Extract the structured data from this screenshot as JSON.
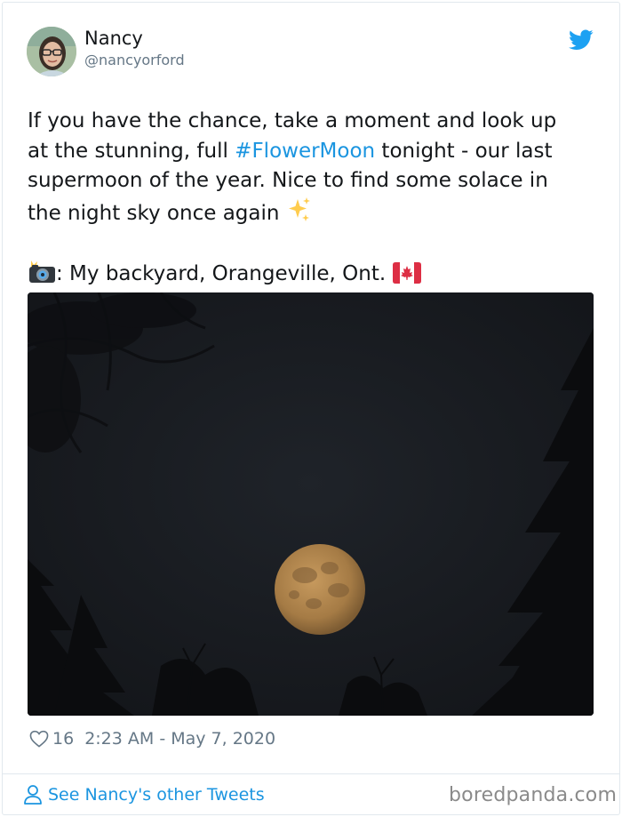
{
  "user": {
    "name": "Nancy",
    "handle": "@nancyorford"
  },
  "tweet": {
    "line1": "If you have the chance, take a moment and look up",
    "line2_start": "at the stunning, full ",
    "hashtag": "#FlowerMoon",
    "line2_end": " tonight - our last",
    "line3": "supermoon of the year. Nice to find some solace in",
    "line4": "the night sky once again",
    "line5_text": ": My backyard, Orangeville, Ont."
  },
  "meta": {
    "likes": "16",
    "timestamp": "2:23 AM - May 7, 2020"
  },
  "footer": {
    "see_more": "See Nancy's other Tweets",
    "watermark": "boredpanda.com"
  },
  "icons": {
    "like": "heart-icon",
    "profile": "person-icon",
    "brand": "twitter-bird-icon",
    "sparkles": "sparkles-emoji",
    "camera": "camera-flash-emoji",
    "flag": "canada-flag-emoji"
  },
  "colors": {
    "link": "#1b95e0",
    "secondary_text": "#657786",
    "text": "#14171a",
    "border": "#e1e8ed"
  }
}
